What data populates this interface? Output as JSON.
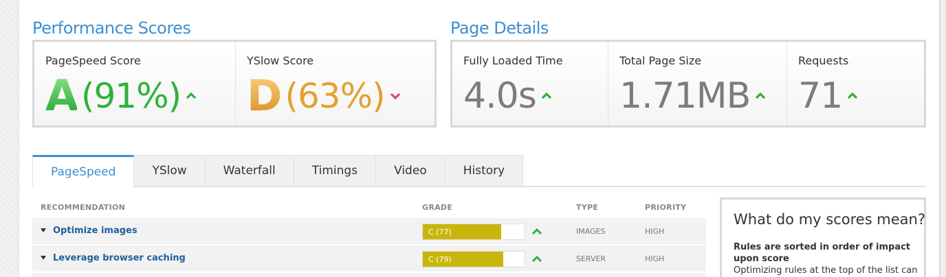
{
  "colors": {
    "accent": "#3a8fd3",
    "good": "#2cb239",
    "warn": "#e3a131",
    "bad": "#e0455e",
    "bar": "#c9b60c"
  },
  "performance": {
    "title": "Performance Scores",
    "pagespeed": {
      "label": "PageSpeed Score",
      "grade": "A",
      "percent": "(91%)",
      "trend_icon": "arrow-up-icon"
    },
    "yslow": {
      "label": "YSlow Score",
      "grade": "D",
      "percent": "(63%)",
      "trend_icon": "arrow-down-icon"
    }
  },
  "details": {
    "title": "Page Details",
    "load_time": {
      "label": "Fully Loaded Time",
      "value": "4.0s",
      "trend_icon": "arrow-up-icon"
    },
    "page_size": {
      "label": "Total Page Size",
      "value": "1.71MB",
      "trend_icon": "arrow-up-icon"
    },
    "requests": {
      "label": "Requests",
      "value": "71",
      "trend_icon": "arrow-up-icon"
    }
  },
  "tabs": [
    {
      "label": "PageSpeed",
      "active": true
    },
    {
      "label": "YSlow"
    },
    {
      "label": "Waterfall"
    },
    {
      "label": "Timings"
    },
    {
      "label": "Video"
    },
    {
      "label": "History"
    }
  ],
  "table": {
    "headers": {
      "recommendation": "RECOMMENDATION",
      "grade": "GRADE",
      "type": "TYPE",
      "priority": "PRIORITY"
    },
    "rows": [
      {
        "name": "Optimize images",
        "grade": "C (77)",
        "score": 0.77,
        "type": "IMAGES",
        "priority": "HIGH"
      },
      {
        "name": "Leverage browser caching",
        "grade": "C (79)",
        "score": 0.79,
        "type": "SERVER",
        "priority": "HIGH"
      }
    ]
  },
  "sidebar": {
    "title": "What do my scores mean?",
    "bold": "Rules are sorted in order of impact upon score",
    "body": "Optimizing rules at the top of the list can"
  }
}
